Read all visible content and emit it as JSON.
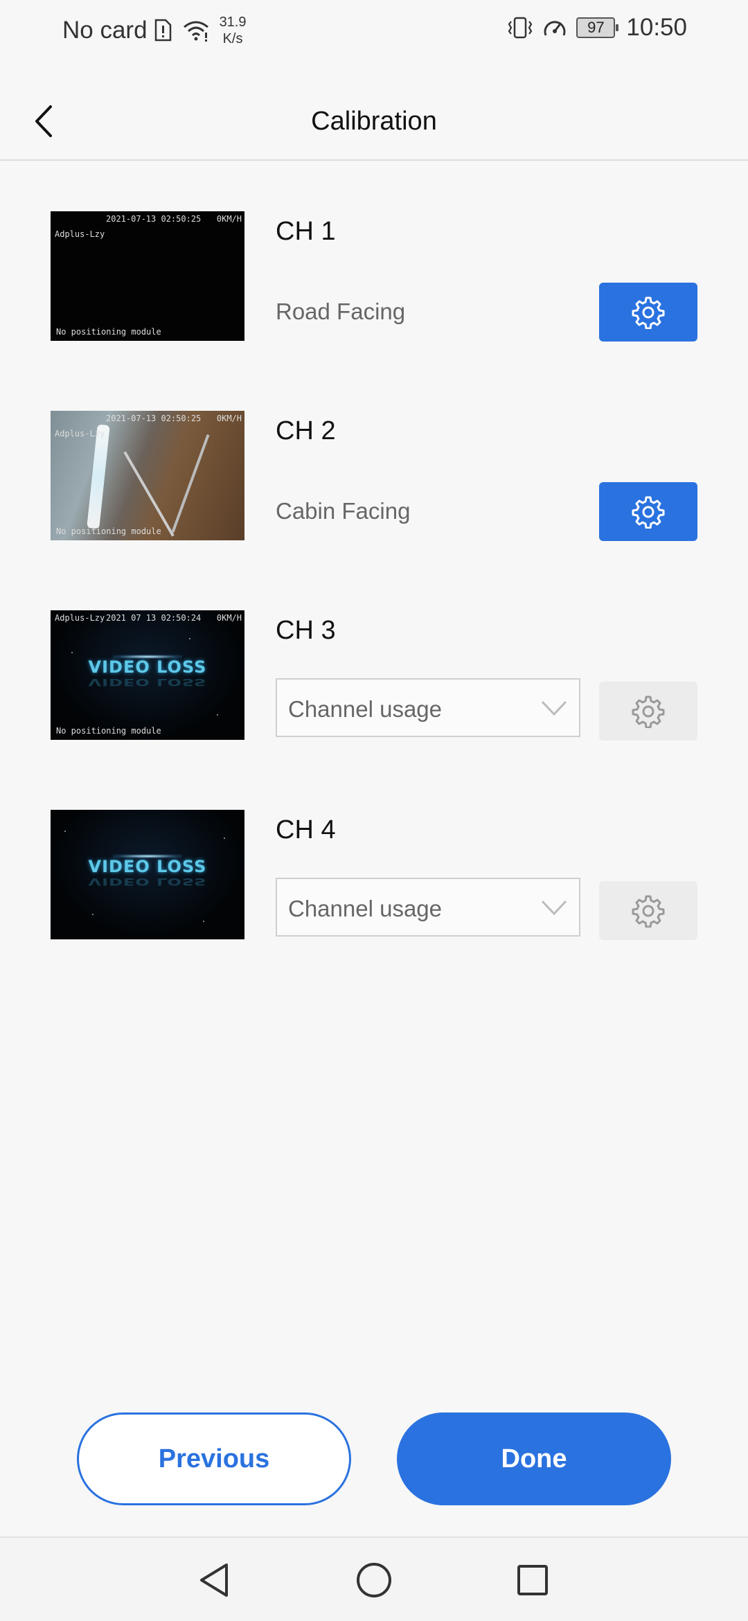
{
  "status_bar": {
    "carrier": "No card",
    "speed_value": "31.9",
    "speed_unit": "K/s",
    "battery": "97",
    "time": "10:50"
  },
  "header": {
    "title": "Calibration"
  },
  "channels": [
    {
      "label": "CH 1",
      "usage": "Road Facing",
      "settings_enabled": true,
      "preview": {
        "timestamp": "2021-07-13 02:50:25",
        "top_right": "0KM/H",
        "name": "Adplus-Lzy",
        "bottom": "No positioning module"
      }
    },
    {
      "label": "CH 2",
      "usage": "Cabin Facing",
      "settings_enabled": true,
      "preview": {
        "timestamp": "2021-07-13 02:50:25",
        "top_right": "0KM/H",
        "name": "Adplus-Lzy",
        "bottom": "No positioning module"
      }
    },
    {
      "label": "CH 3",
      "usage_placeholder": "Channel usage",
      "settings_enabled": false,
      "preview": {
        "timestamp": "2021 07 13 02:50:24",
        "top_right": "0KM/H",
        "name": "Adplus-Lzy",
        "bottom": "No positioning module",
        "overlay": "VIDEO LOSS"
      }
    },
    {
      "label": "CH 4",
      "usage_placeholder": "Channel usage",
      "settings_enabled": false,
      "preview": {
        "overlay": "VIDEO LOSS"
      }
    }
  ],
  "footer": {
    "previous_label": "Previous",
    "done_label": "Done"
  },
  "icons": {
    "back": "chevron-left-icon",
    "settings": "gear-icon",
    "dropdown": "chevron-down-icon",
    "nav_back": "triangle-back-icon",
    "nav_home": "circle-home-icon",
    "nav_recent": "square-recents-icon"
  },
  "colors": {
    "accent": "#2a72df",
    "background": "#f7f7f7",
    "disabled_button": "#ececec"
  }
}
